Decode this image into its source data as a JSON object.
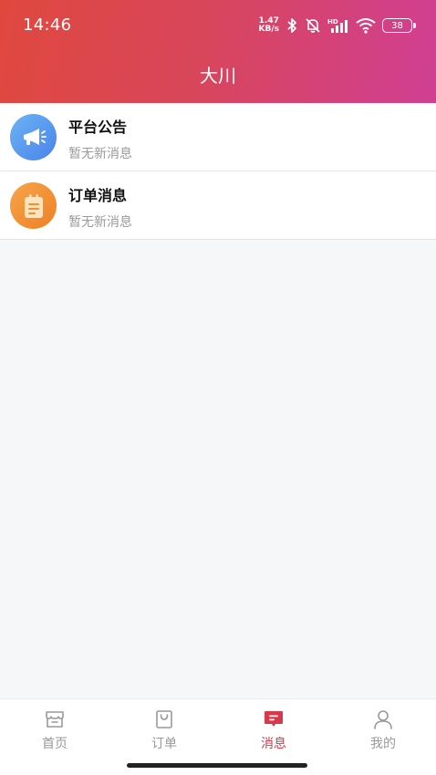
{
  "status_bar": {
    "time": "14:46",
    "net_speed_value": "1.47",
    "net_speed_unit": "KB/s",
    "battery": "38"
  },
  "header": {
    "title": "大川"
  },
  "messages": [
    {
      "title": "平台公告",
      "subtitle": "暂无新消息",
      "icon": "megaphone-icon",
      "color": "#5a9df0"
    },
    {
      "title": "订单消息",
      "subtitle": "暂无新消息",
      "icon": "clipboard-icon",
      "color": "#f08f34"
    }
  ],
  "tabbar": {
    "active": "消息",
    "accent": "#d6394c",
    "tabs": [
      {
        "label": "首页",
        "icon": "store-icon"
      },
      {
        "label": "订单",
        "icon": "bag-icon"
      },
      {
        "label": "消息",
        "icon": "message-icon"
      },
      {
        "label": "我的",
        "icon": "person-icon"
      }
    ]
  }
}
